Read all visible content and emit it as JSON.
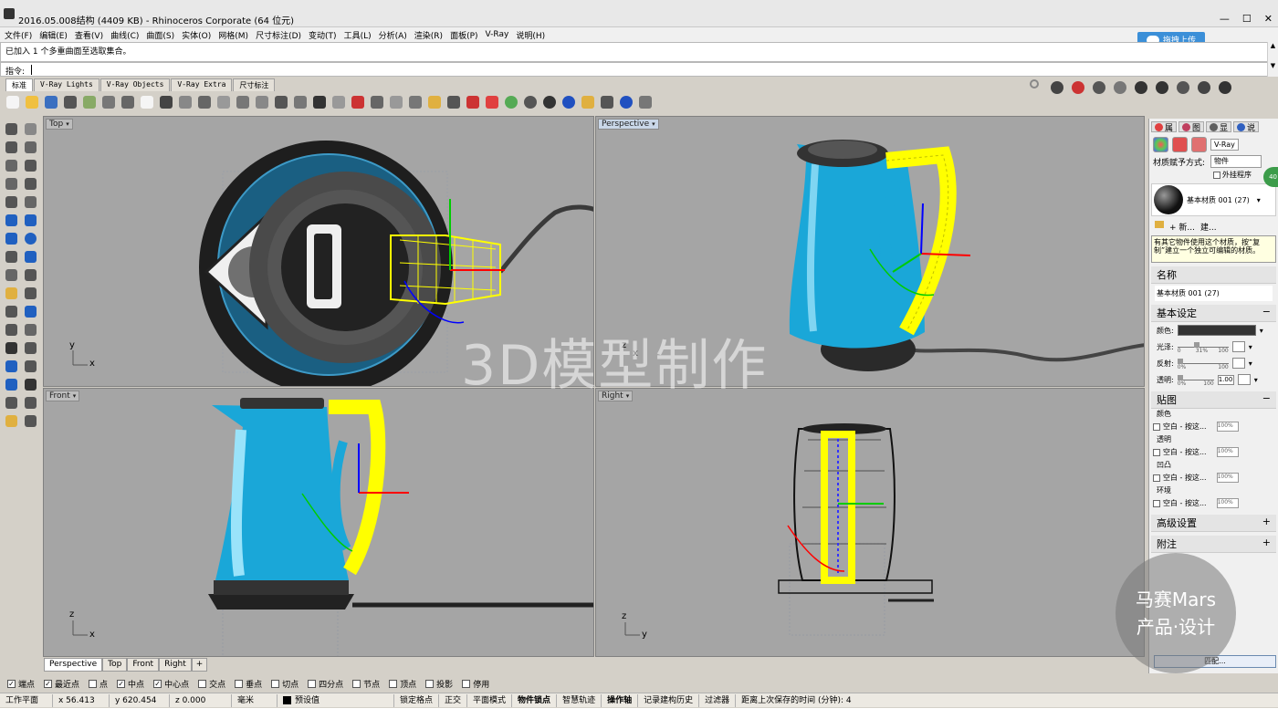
{
  "window": {
    "title": "2016.05.008结构 (4409 KB) - Rhinoceros Corporate (64 位元)",
    "minimize": "—",
    "maximize": "☐",
    "close": "✕"
  },
  "menu": [
    "文件(F)",
    "编辑(E)",
    "查看(V)",
    "曲线(C)",
    "曲面(S)",
    "实体(O)",
    "网格(M)",
    "尺寸标注(D)",
    "变动(T)",
    "工具(L)",
    "分析(A)",
    "渲染(R)",
    "面板(P)",
    "V-Ray",
    "说明(H)"
  ],
  "cloud_upload": "拖拽上传",
  "history": {
    "line": "已加入 1 个多重曲面至选取集合。"
  },
  "command": {
    "label": "指令:"
  },
  "scroll": {
    "up": "▲",
    "down": "▼"
  },
  "toolbar_tabs": [
    "标准",
    "V-Ray Lights",
    "V-Ray Objects",
    "V-Ray Extra",
    "尺寸标注"
  ],
  "toolbar_icons": [
    "new-icon",
    "open-icon",
    "save-icon",
    "print-icon",
    "import-icon",
    "cut-icon",
    "copy-icon",
    "paste-icon",
    "undo-icon",
    "pan-icon",
    "rotate-view-icon",
    "zoom-window-icon",
    "zoom-extents-icon",
    "zoom-selected-icon",
    "zoom-icon",
    "undo-view-icon",
    "four-view-icon",
    "cplane-icon",
    "car-icon",
    "grid-icon",
    "snap-icon",
    "point-icon",
    "light-icon",
    "lock-icon",
    "layer-icon",
    "material-icon",
    "color-wheel-icon",
    "sphere-icon",
    "render-sphere-icon",
    "blue-sphere-icon",
    "spotlight-icon",
    "gear-icon",
    "info-icon",
    "cursor-icon"
  ],
  "right_toolbar_icons": [
    "vray-render-icon",
    "vray-stop-icon",
    "vray-frame-icon",
    "vray-options-icon",
    "vray-ipr-icon",
    "check-icon",
    "teapot-icon",
    "camera-icon",
    "vray-vfb-icon"
  ],
  "left_tool_icons": [
    "select-icon",
    "point-icon",
    "polyline-icon",
    "curve-icon",
    "circle-icon",
    "ellipse-icon",
    "arc-icon",
    "rect-icon",
    "polygon-icon",
    "freeform-icon",
    "surface-icon",
    "extrude-icon",
    "box-icon",
    "sphere-icon",
    "cylinder-icon",
    "mesh-icon",
    "pipe-icon",
    "loft-icon",
    "boolean-icon",
    "fillet-icon",
    "move-icon",
    "rotate-icon",
    "scale-icon",
    "array-icon",
    "text-icon",
    "dimension-icon",
    "grid-icon",
    "trim-icon",
    "solid-icon",
    "explode-icon",
    "check-icon",
    "analyze-icon",
    "render-icon",
    "paint-icon"
  ],
  "viewports": {
    "top": {
      "label": "Top"
    },
    "perspective": {
      "label": "Perspective"
    },
    "front": {
      "label": "Front"
    },
    "right": {
      "label": "Right"
    }
  },
  "watermark": "3D模型制作",
  "axes": {
    "top": [
      "y",
      "x"
    ],
    "perspective": [
      "z",
      "x"
    ],
    "front": [
      "z",
      "x"
    ],
    "right": [
      "z",
      "y"
    ]
  },
  "viewport_tabs": [
    "Perspective",
    "Top",
    "Front",
    "Right"
  ],
  "viewport_tab_add": "+",
  "osnaps": [
    {
      "label": "端点",
      "checked": true
    },
    {
      "label": "最近点",
      "checked": true
    },
    {
      "label": "点",
      "checked": false
    },
    {
      "label": "中点",
      "checked": true
    },
    {
      "label": "中心点",
      "checked": true
    },
    {
      "label": "交点",
      "checked": false
    },
    {
      "label": "垂点",
      "checked": false
    },
    {
      "label": "切点",
      "checked": false
    },
    {
      "label": "四分点",
      "checked": false
    },
    {
      "label": "节点",
      "checked": false
    },
    {
      "label": "顶点",
      "checked": false
    },
    {
      "label": "投影",
      "checked": false
    },
    {
      "label": "停用",
      "checked": false
    }
  ],
  "checkmark": "✓",
  "status": {
    "cplane": "工作平面",
    "x": "x 56.413",
    "y": "y 620.454",
    "z": "z 0.000",
    "unit": "毫米",
    "layer": "预设值",
    "grid_snap": "锁定格点",
    "ortho": "正交",
    "planar": "平面模式",
    "osnap": "物件锁点",
    "smarttrack": "智慧轨迹",
    "gumball": "操作轴",
    "history": "记录建构历史",
    "filter": "过滤器",
    "save_time": "距离上次保存的时间 (分钟): 4"
  },
  "panel": {
    "tabs": [
      "属",
      "图",
      "显",
      "说"
    ],
    "vray": "V-Ray",
    "assign_label": "材质赋予方式:",
    "assign_value": "物件",
    "plugin_label": "外挂程序",
    "green_badge": "40",
    "material_name": "基本材质 001 (27)",
    "new_btn": "新...",
    "create_btn": "建...",
    "notice": "有其它物件使用这个材质，按“复制”建立一个独立可编辑的材质。",
    "name_header": "名称",
    "name_value": "基本材质 001 (27)",
    "basic_header": "基本设定",
    "collapse": "−",
    "expand": "+",
    "dropdown": "▾",
    "color_label": "颜色:",
    "gloss_label": "光泽:",
    "reflect_label": "反射:",
    "transp_label": "透明:",
    "slider_min": "0",
    "slider_max": "100",
    "gloss_value": "31%",
    "reflect_value": "0%",
    "transp_value": "0%",
    "ior_value": "1.00",
    "maps_header": "贴图",
    "maps": [
      {
        "label": "颜色",
        "value": "空白 - 按这..."
      },
      {
        "label": "透明",
        "value": "空白 - 按这..."
      },
      {
        "label": "凹凸",
        "value": "空白 - 按这..."
      },
      {
        "label": "环境",
        "value": "空白 - 按这..."
      }
    ],
    "map_pct": "100%",
    "advanced_header": "高级设置",
    "notes_header": "附注",
    "match_btn": "匹配...",
    "badge_line1": "马赛Mars",
    "badge_line2": "产品·设计"
  },
  "colors": {
    "kettle_blue": "#1aa7d8",
    "wire_yellow": "#ffff00",
    "viewport_bg": "#a5a5a5"
  }
}
